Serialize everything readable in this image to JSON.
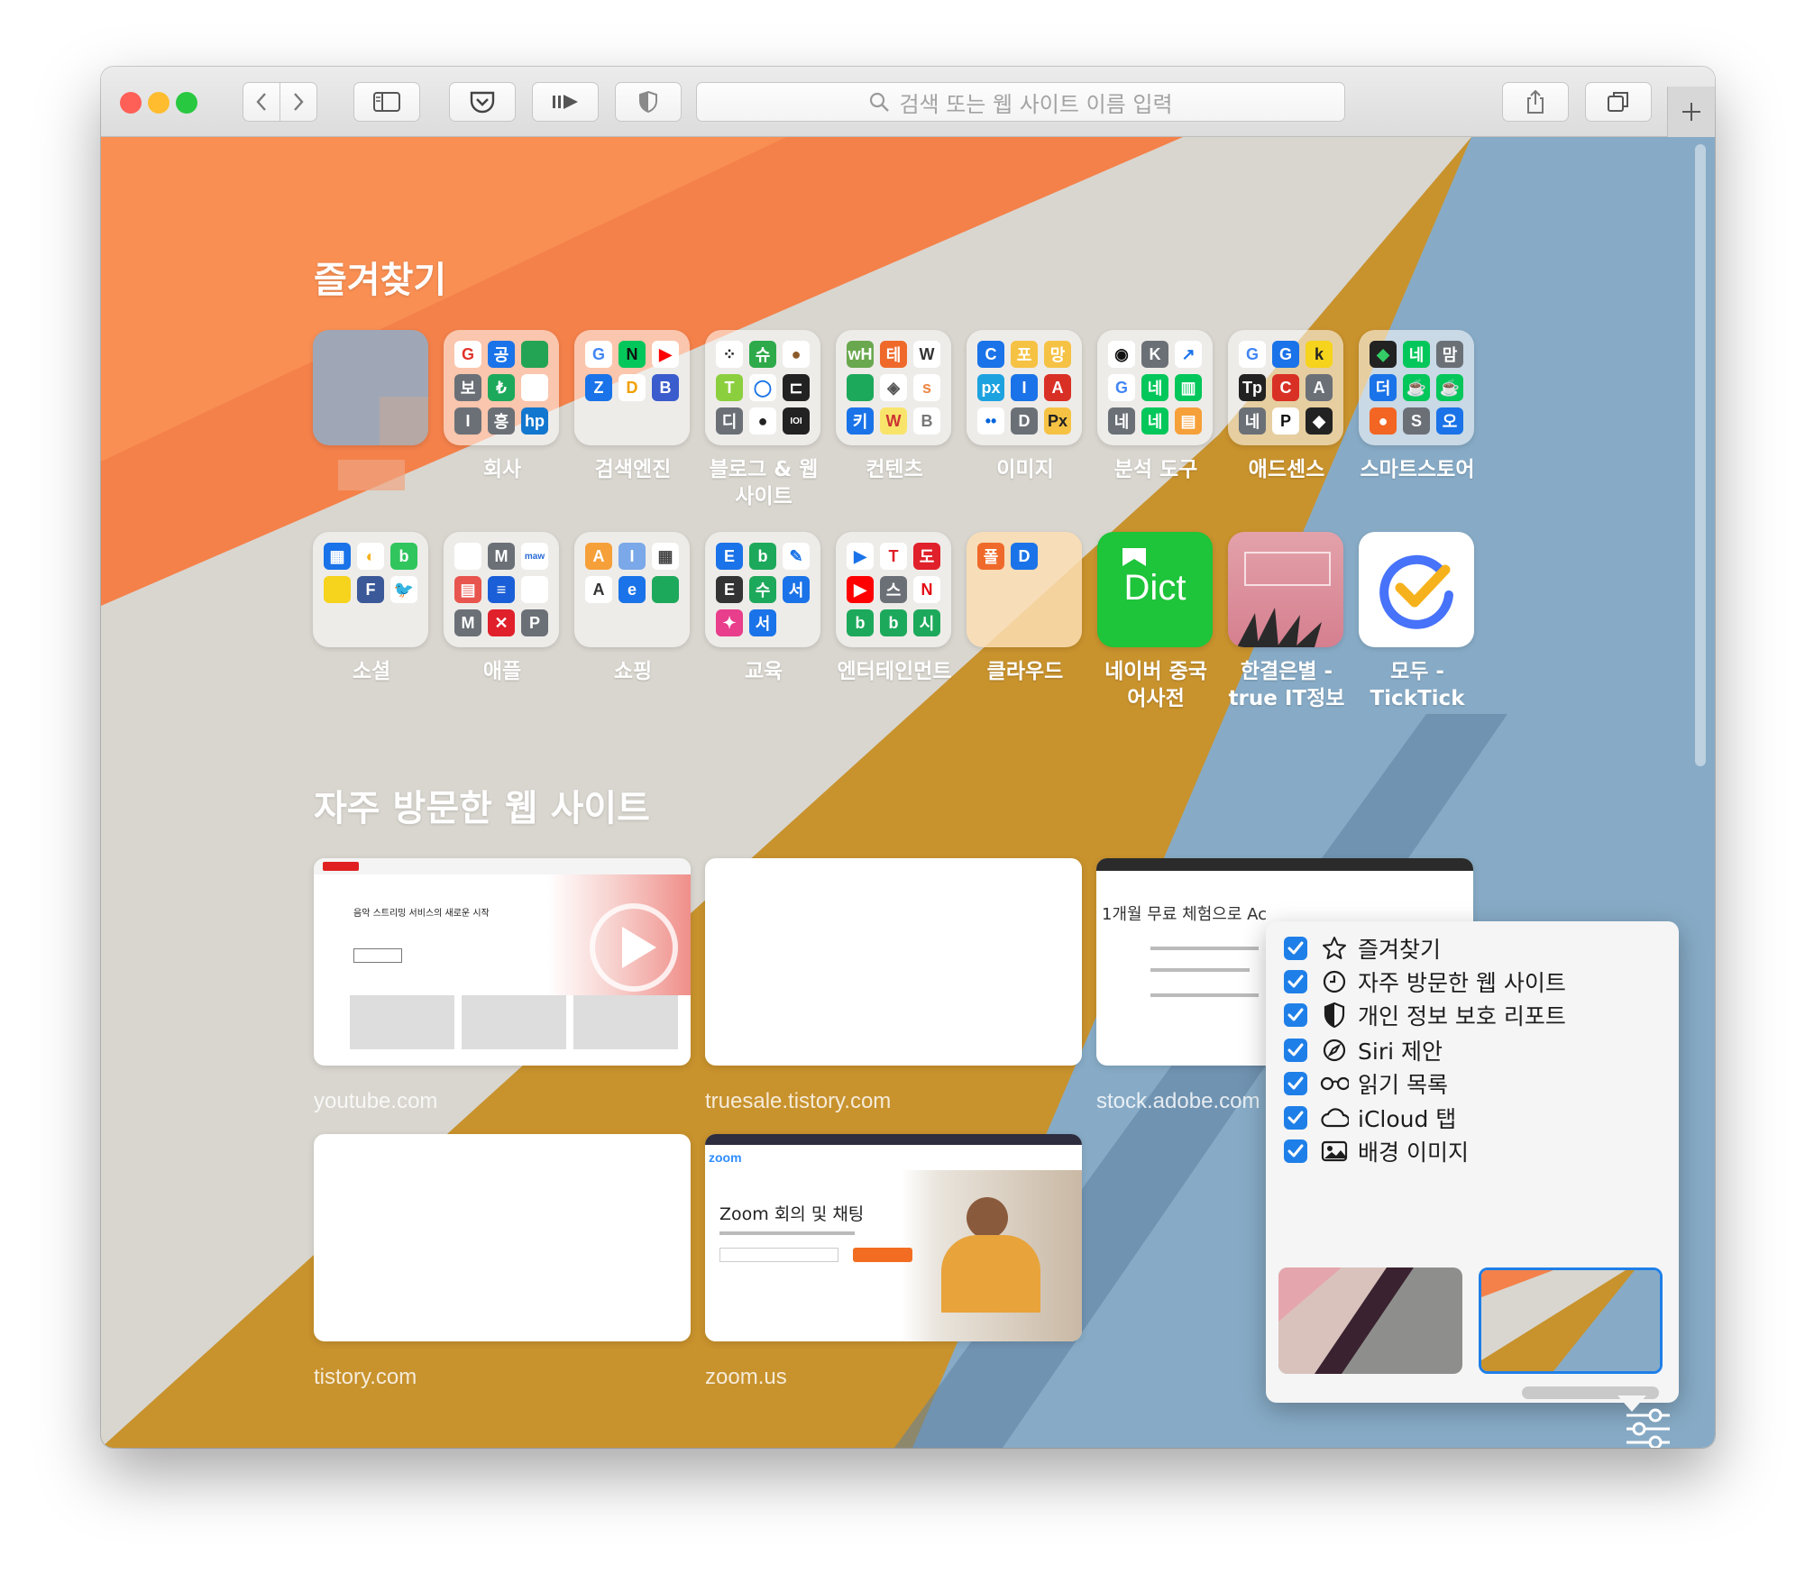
{
  "toolbar": {
    "address_placeholder": "검색 또는 웹 사이트 이름 입력",
    "traffic_colors": [
      "#fe5f57",
      "#febc2e",
      "#28c840"
    ]
  },
  "favorites": {
    "title": "즐겨찾기",
    "items": [
      {
        "label": "",
        "tiles": []
      },
      {
        "label": "회사",
        "tiles": [
          {
            "t": "G",
            "bg": "#ffffff",
            "fg": "#e1322b"
          },
          {
            "t": "공",
            "bg": "#1a73e8",
            "fg": "#fff"
          },
          {
            "t": "",
            "bg": "#23a455",
            "fg": "#fff"
          },
          {
            "t": "보",
            "bg": "#6b7077",
            "fg": "#fff"
          },
          {
            "t": "₺",
            "bg": "#1da95b",
            "fg": "#fff"
          },
          {
            "t": "",
            "bg": "#ffffff",
            "fg": "#f47920"
          },
          {
            "t": "I",
            "bg": "#6b7077",
            "fg": "#fff"
          },
          {
            "t": "흥",
            "bg": "#6b7077",
            "fg": "#fff"
          },
          {
            "t": "hp",
            "bg": "#1177cf",
            "fg": "#fff"
          }
        ]
      },
      {
        "label": "검색엔진",
        "tiles": [
          {
            "t": "G",
            "bg": "#ffffff",
            "fg": "#4285f4"
          },
          {
            "t": "N",
            "bg": "#03c75a",
            "fg": "#111"
          },
          {
            "t": "▶",
            "bg": "#ffffff",
            "fg": "#ff0000"
          },
          {
            "t": "Z",
            "bg": "#1a73e8",
            "fg": "#fff"
          },
          {
            "t": "D",
            "bg": "#ffffff",
            "fg": "#f0a000"
          },
          {
            "t": "B",
            "bg": "#3b5ccc",
            "fg": "#fff"
          }
        ]
      },
      {
        "label": "블로그 & 웹 사이트",
        "tiles": [
          {
            "t": "⁘",
            "bg": "#ffffff",
            "fg": "#222"
          },
          {
            "t": "슈",
            "bg": "#2eaa4a",
            "fg": "#fff"
          },
          {
            "t": "●",
            "bg": "#ffffff",
            "fg": "#8a5a2b"
          },
          {
            "t": "T",
            "bg": "#8ccf3e",
            "fg": "#fff"
          },
          {
            "t": "◯",
            "bg": "#ffffff",
            "fg": "#1a73e8"
          },
          {
            "t": "⊏",
            "bg": "#222222",
            "fg": "#fff"
          },
          {
            "t": "디",
            "bg": "#6b7077",
            "fg": "#fff"
          },
          {
            "t": "●",
            "bg": "#ffffff",
            "fg": "#222"
          },
          {
            "t": "IOI",
            "bg": "#222222",
            "fg": "#fff"
          }
        ]
      },
      {
        "label": "컨텐츠",
        "tiles": [
          {
            "t": "wH",
            "bg": "#6aa84f",
            "fg": "#fff"
          },
          {
            "t": "테",
            "bg": "#ef6a2a",
            "fg": "#fff"
          },
          {
            "t": "W",
            "bg": "#ffffff",
            "fg": "#333"
          },
          {
            "t": "",
            "bg": "#1da95b",
            "fg": "#fff"
          },
          {
            "t": "◈",
            "bg": "#ffffff",
            "fg": "#555"
          },
          {
            "t": "s",
            "bg": "#ffffff",
            "fg": "#e84"
          },
          {
            "t": "키",
            "bg": "#1a73e8",
            "fg": "#fff"
          },
          {
            "t": "W",
            "bg": "#f8e46a",
            "fg": "#c33"
          },
          {
            "t": "B",
            "bg": "#ffffff",
            "fg": "#777"
          }
        ]
      },
      {
        "label": "이미지",
        "tiles": [
          {
            "t": "C",
            "bg": "#1a73e8",
            "fg": "#fff"
          },
          {
            "t": "포",
            "bg": "#f6c244",
            "fg": "#fff"
          },
          {
            "t": "망",
            "bg": "#f6c244",
            "fg": "#fff"
          },
          {
            "t": "px",
            "bg": "#1da2e0",
            "fg": "#fff"
          },
          {
            "t": "I",
            "bg": "#1a73e8",
            "fg": "#fff"
          },
          {
            "t": "A",
            "bg": "#d93025",
            "fg": "#fff"
          },
          {
            "t": "••",
            "bg": "#ffffff",
            "fg": "#0063dc"
          },
          {
            "t": "D",
            "bg": "#6b7077",
            "fg": "#fff"
          },
          {
            "t": "Px",
            "bg": "#f6c244",
            "fg": "#222"
          }
        ]
      },
      {
        "label": "분석 도구",
        "tiles": [
          {
            "t": "◉",
            "bg": "#ffffff",
            "fg": "#111"
          },
          {
            "t": "K",
            "bg": "#6b7077",
            "fg": "#fff"
          },
          {
            "t": "↗",
            "bg": "#ffffff",
            "fg": "#1a73e8"
          },
          {
            "t": "G",
            "bg": "#ffffff",
            "fg": "#4285f4"
          },
          {
            "t": "네",
            "bg": "#03c75a",
            "fg": "#fff"
          },
          {
            "t": "▥",
            "bg": "#03c75a",
            "fg": "#fff"
          },
          {
            "t": "네",
            "bg": "#6b7077",
            "fg": "#fff"
          },
          {
            "t": "네",
            "bg": "#03c75a",
            "fg": "#fff"
          },
          {
            "t": "▤",
            "bg": "#f6a03a",
            "fg": "#fff"
          }
        ]
      },
      {
        "label": "애드센스",
        "tiles": [
          {
            "t": "G",
            "bg": "#ffffff",
            "fg": "#4285f4"
          },
          {
            "t": "G",
            "bg": "#1a73e8",
            "fg": "#fff"
          },
          {
            "t": "k",
            "bg": "#f6d31c",
            "fg": "#222"
          },
          {
            "t": "Tp",
            "bg": "#222222",
            "fg": "#fff"
          },
          {
            "t": "C",
            "bg": "#d93025",
            "fg": "#fff"
          },
          {
            "t": "A",
            "bg": "#6b7077",
            "fg": "#fff"
          },
          {
            "t": "네",
            "bg": "#6b7077",
            "fg": "#fff"
          },
          {
            "t": "P",
            "bg": "#ffffff",
            "fg": "#111"
          },
          {
            "t": "◆",
            "bg": "#222222",
            "fg": "#fff"
          }
        ]
      },
      {
        "label": "스마트스토어",
        "tiles": [
          {
            "t": "◆",
            "bg": "#222222",
            "fg": "#3c6"
          },
          {
            "t": "네",
            "bg": "#03c75a",
            "fg": "#fff"
          },
          {
            "t": "맘",
            "bg": "#6b7077",
            "fg": "#fff"
          },
          {
            "t": "더",
            "bg": "#1a73e8",
            "fg": "#fff"
          },
          {
            "t": "☕",
            "bg": "#03c75a",
            "fg": "#fff"
          },
          {
            "t": "☕",
            "bg": "#03c75a",
            "fg": "#fff"
          },
          {
            "t": "●",
            "bg": "#f26522",
            "fg": "#fff"
          },
          {
            "t": "S",
            "bg": "#6b7077",
            "fg": "#fff"
          },
          {
            "t": "오",
            "bg": "#1a73e8",
            "fg": "#fff"
          }
        ]
      },
      {
        "label": "소셜",
        "tiles": [
          {
            "t": "▦",
            "bg": "#1a73e8",
            "fg": "#fff"
          },
          {
            "t": "◐",
            "bg": "#ffffff",
            "fg": "#f6b21c"
          },
          {
            "t": "b",
            "bg": "#31c55e",
            "fg": "#fff"
          },
          {
            "t": "",
            "bg": "#f6d31c",
            "fg": "#fff"
          },
          {
            "t": "F",
            "bg": "#3b5998",
            "fg": "#fff"
          },
          {
            "t": "🐦",
            "bg": "#ffffff",
            "fg": "#1da1f2"
          }
        ]
      },
      {
        "label": "애플",
        "tiles": [
          {
            "t": "",
            "bg": "#ffffff",
            "fg": "#555"
          },
          {
            "t": "M",
            "bg": "#6b7077",
            "fg": "#fff"
          },
          {
            "t": "maw",
            "bg": "#ffffff",
            "fg": "#2a6bd8"
          },
          {
            "t": "▤",
            "bg": "#e8554e",
            "fg": "#fff"
          },
          {
            "t": "≡",
            "bg": "#1a5fd8",
            "fg": "#fff"
          },
          {
            "t": "",
            "bg": "#ffffff",
            "fg": "#555"
          },
          {
            "t": "M",
            "bg": "#6b7077",
            "fg": "#fff"
          },
          {
            "t": "✕",
            "bg": "#e0202a",
            "fg": "#fff"
          },
          {
            "t": "P",
            "bg": "#6b7077",
            "fg": "#fff"
          }
        ]
      },
      {
        "label": "쇼핑",
        "tiles": [
          {
            "t": "A",
            "bg": "#f6a03a",
            "fg": "#fff"
          },
          {
            "t": "I",
            "bg": "#7aa8e8",
            "fg": "#fff"
          },
          {
            "t": "▦",
            "bg": "#ffffff",
            "fg": "#444"
          },
          {
            "t": "A",
            "bg": "#ffffff",
            "fg": "#333"
          },
          {
            "t": "e",
            "bg": "#1a73e8",
            "fg": "#fff"
          },
          {
            "t": "",
            "bg": "#1da95b",
            "fg": "#fff"
          }
        ]
      },
      {
        "label": "교육",
        "tiles": [
          {
            "t": "E",
            "bg": "#1a73e8",
            "fg": "#fff"
          },
          {
            "t": "b",
            "bg": "#1da95b",
            "fg": "#fff"
          },
          {
            "t": "✎",
            "bg": "#ffffff",
            "fg": "#1a73e8"
          },
          {
            "t": "E",
            "bg": "#333333",
            "fg": "#fff"
          },
          {
            "t": "수",
            "bg": "#1da95b",
            "fg": "#fff"
          },
          {
            "t": "서",
            "bg": "#1a73e8",
            "fg": "#fff"
          },
          {
            "t": "✦",
            "bg": "#e83e8c",
            "fg": "#fff"
          },
          {
            "t": "서",
            "bg": "#1a73e8",
            "fg": "#fff"
          }
        ]
      },
      {
        "label": "엔터테인먼트",
        "tiles": [
          {
            "t": "▶",
            "bg": "#ffffff",
            "fg": "#1a73e8"
          },
          {
            "t": "T",
            "bg": "#ffffff",
            "fg": "#e0202a"
          },
          {
            "t": "도",
            "bg": "#e0202a",
            "fg": "#fff"
          },
          {
            "t": "▶",
            "bg": "#ff0000",
            "fg": "#fff"
          },
          {
            "t": "스",
            "bg": "#6b7077",
            "fg": "#fff"
          },
          {
            "t": "N",
            "bg": "#ffffff",
            "fg": "#e50914"
          },
          {
            "t": "b",
            "bg": "#1da95b",
            "fg": "#fff"
          },
          {
            "t": "b",
            "bg": "#1da95b",
            "fg": "#fff"
          },
          {
            "t": "시",
            "bg": "#1da95b",
            "fg": "#fff"
          }
        ]
      },
      {
        "label": "클라우드",
        "tiles": [
          {
            "t": "폴",
            "bg": "#ef6a2a",
            "fg": "#fff"
          },
          {
            "t": "D",
            "bg": "#1a73e8",
            "fg": "#fff"
          }
        ]
      },
      {
        "label": "네이버 중국어사전",
        "tiles": []
      },
      {
        "label": "한결은별 - true IT정보",
        "tiles": []
      },
      {
        "label": "모두 - TickTick",
        "tiles": []
      }
    ]
  },
  "frequent": {
    "title": "자주 방문한 웹 사이트",
    "sites": [
      {
        "label": "youtube.com",
        "text": "음악 스트리밍 서비스의 새로운 시작"
      },
      {
        "label": "truesale.tistory.com",
        "text": ""
      },
      {
        "label": "stock.adobe.com",
        "text": "1개월 무료 체험으로 Ac"
      },
      {
        "label": "tistory.com",
        "text": ""
      },
      {
        "label": "zoom.us",
        "text": "Zoom 회의 및 채팅"
      }
    ]
  },
  "special_tiles": {
    "dict": "Dict",
    "brand_logo": "zoom"
  },
  "popover": {
    "options": [
      {
        "label": "즐겨찾기",
        "icon": "star-icon",
        "checked": true
      },
      {
        "label": "자주 방문한 웹 사이트",
        "icon": "clock-icon",
        "checked": true
      },
      {
        "label": "개인 정보 보호 리포트",
        "icon": "shield-icon",
        "checked": true
      },
      {
        "label": "Siri 제안",
        "icon": "compass-icon",
        "checked": true
      },
      {
        "label": "읽기 목록",
        "icon": "glasses-icon",
        "checked": true
      },
      {
        "label": "iCloud 탭",
        "icon": "cloud-icon",
        "checked": true
      },
      {
        "label": "배경 이미지",
        "icon": "image-icon",
        "checked": true
      }
    ],
    "accent": "#1f7fe8"
  }
}
